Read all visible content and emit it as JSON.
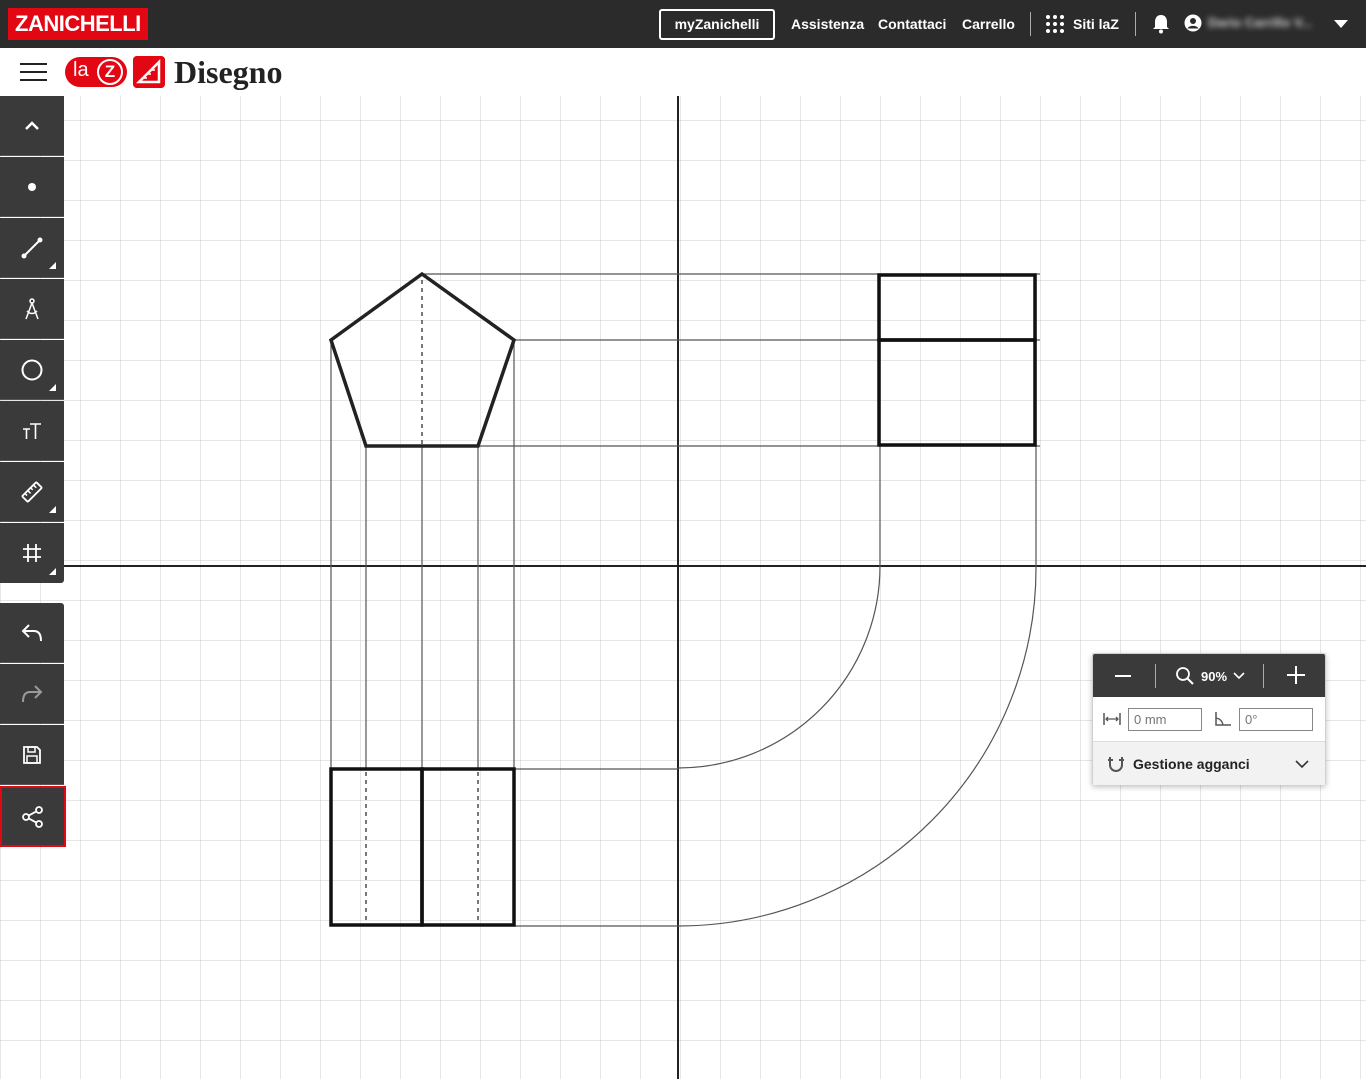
{
  "topbar": {
    "brand": "ZANICHELLI",
    "my_button": "myZanichelli",
    "links": [
      "Assistenza",
      "Contattaci",
      "Carrello"
    ],
    "siti": "Siti laZ",
    "user_name": "Dario Carrillo V..."
  },
  "header": {
    "laz_la": "la",
    "laz_z": "Z",
    "title": "Disegno"
  },
  "zoom_panel": {
    "zoom_value": "90%",
    "length_placeholder": "0 mm",
    "angle_placeholder": "0°",
    "snap_label": "Gestione agganci"
  },
  "tools": [
    {
      "name": "collapse-toolbar-button",
      "icon": "chevron-up-icon"
    },
    {
      "name": "point-tool-button",
      "icon": "dot-icon"
    },
    {
      "name": "line-tool-button",
      "icon": "line-icon"
    },
    {
      "name": "compass-tool-button",
      "icon": "compass-icon"
    },
    {
      "name": "circle-tool-button",
      "icon": "circle-icon"
    },
    {
      "name": "text-tool-button",
      "icon": "text-icon"
    },
    {
      "name": "ruler-tool-button",
      "icon": "ruler-icon"
    },
    {
      "name": "grid-tool-button",
      "icon": "grid-icon"
    },
    {
      "name": "undo-button",
      "icon": "undo-icon"
    },
    {
      "name": "redo-button",
      "icon": "redo-icon"
    },
    {
      "name": "save-button",
      "icon": "save-icon"
    },
    {
      "name": "share-button",
      "icon": "share-icon"
    }
  ],
  "colors": {
    "brand_red": "#e30613",
    "topbar_bg": "#2b2b2b",
    "toolbar_bg": "#3a3a3a",
    "grid_line": "#cccccc"
  }
}
